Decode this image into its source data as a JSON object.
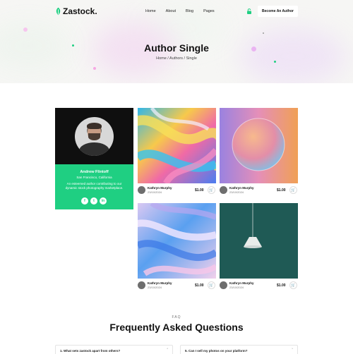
{
  "brand": {
    "name": "Zastock.",
    "accent": "#1fcf82"
  },
  "nav": {
    "items": [
      "Home",
      "About",
      "Blog",
      "Pages"
    ],
    "lock_icon": "lock-icon",
    "cta_label": "Become An Author"
  },
  "hero": {
    "title": "Author Single",
    "breadcrumb": "Home / Authors / Single"
  },
  "author": {
    "name": "Andrew Flintoff",
    "location": "San Francisco, California",
    "bio": "An esteemed author contributing to our dynamic stock photography marketplace.",
    "socials": [
      "f",
      "t",
      "in"
    ]
  },
  "products": [
    {
      "author": "Kathryn Murphy",
      "date": "23/10/2024",
      "price": "$1.00"
    },
    {
      "author": "Kathryn Murphy",
      "date": "23/10/2024",
      "price": "$1.00"
    },
    {
      "author": "Kathryn Murphy",
      "date": "23/10/2024",
      "price": "$1.00"
    },
    {
      "author": "Kathryn Murphy",
      "date": "23/10/2024",
      "price": "$1.00"
    }
  ],
  "faq": {
    "tag": "FAQ",
    "title": "Frequently Asked Questions",
    "questions": [
      "1. What sets zastock apart from others?",
      "5. Can I sell my photos on your platform?"
    ]
  }
}
